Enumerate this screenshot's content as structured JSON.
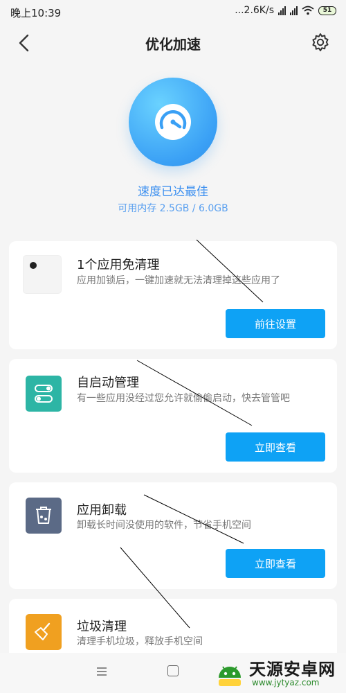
{
  "status_bar": {
    "time": "晚上10:39",
    "net_speed": "...2.6K/s",
    "battery": "51"
  },
  "header": {
    "title": "优化加速",
    "back_icon": "chevron-left-icon",
    "settings_icon": "gear-icon"
  },
  "hero": {
    "status": "速度已达最佳",
    "memory": "可用内存 2.5GB / 6.0GB",
    "accent": "#3aa0f5"
  },
  "cards": [
    {
      "title": "1个应用免清理",
      "desc": "应用加锁后，一键加速就无法清理掉这些应用了",
      "button": "前往设置",
      "icon": "lock-app-icon"
    },
    {
      "title": "自启动管理",
      "desc": "有一些应用没经过您允许就偷偷启动，快去管管吧",
      "button": "立即查看",
      "icon": "toggle-icon",
      "icon_color": "#2db5a5"
    },
    {
      "title": "应用卸载",
      "desc": "卸载长时间没使用的软件，节省手机空间",
      "button": "立即查看",
      "icon": "trash-icon",
      "icon_color": "#5b6a86"
    },
    {
      "title": "垃圾清理",
      "desc": "清理手机垃圾，释放手机空间",
      "icon": "broom-icon",
      "icon_color": "#f0a020"
    }
  ],
  "watermark": {
    "title": "天源安卓网",
    "url": "www.jytyaz.com"
  }
}
